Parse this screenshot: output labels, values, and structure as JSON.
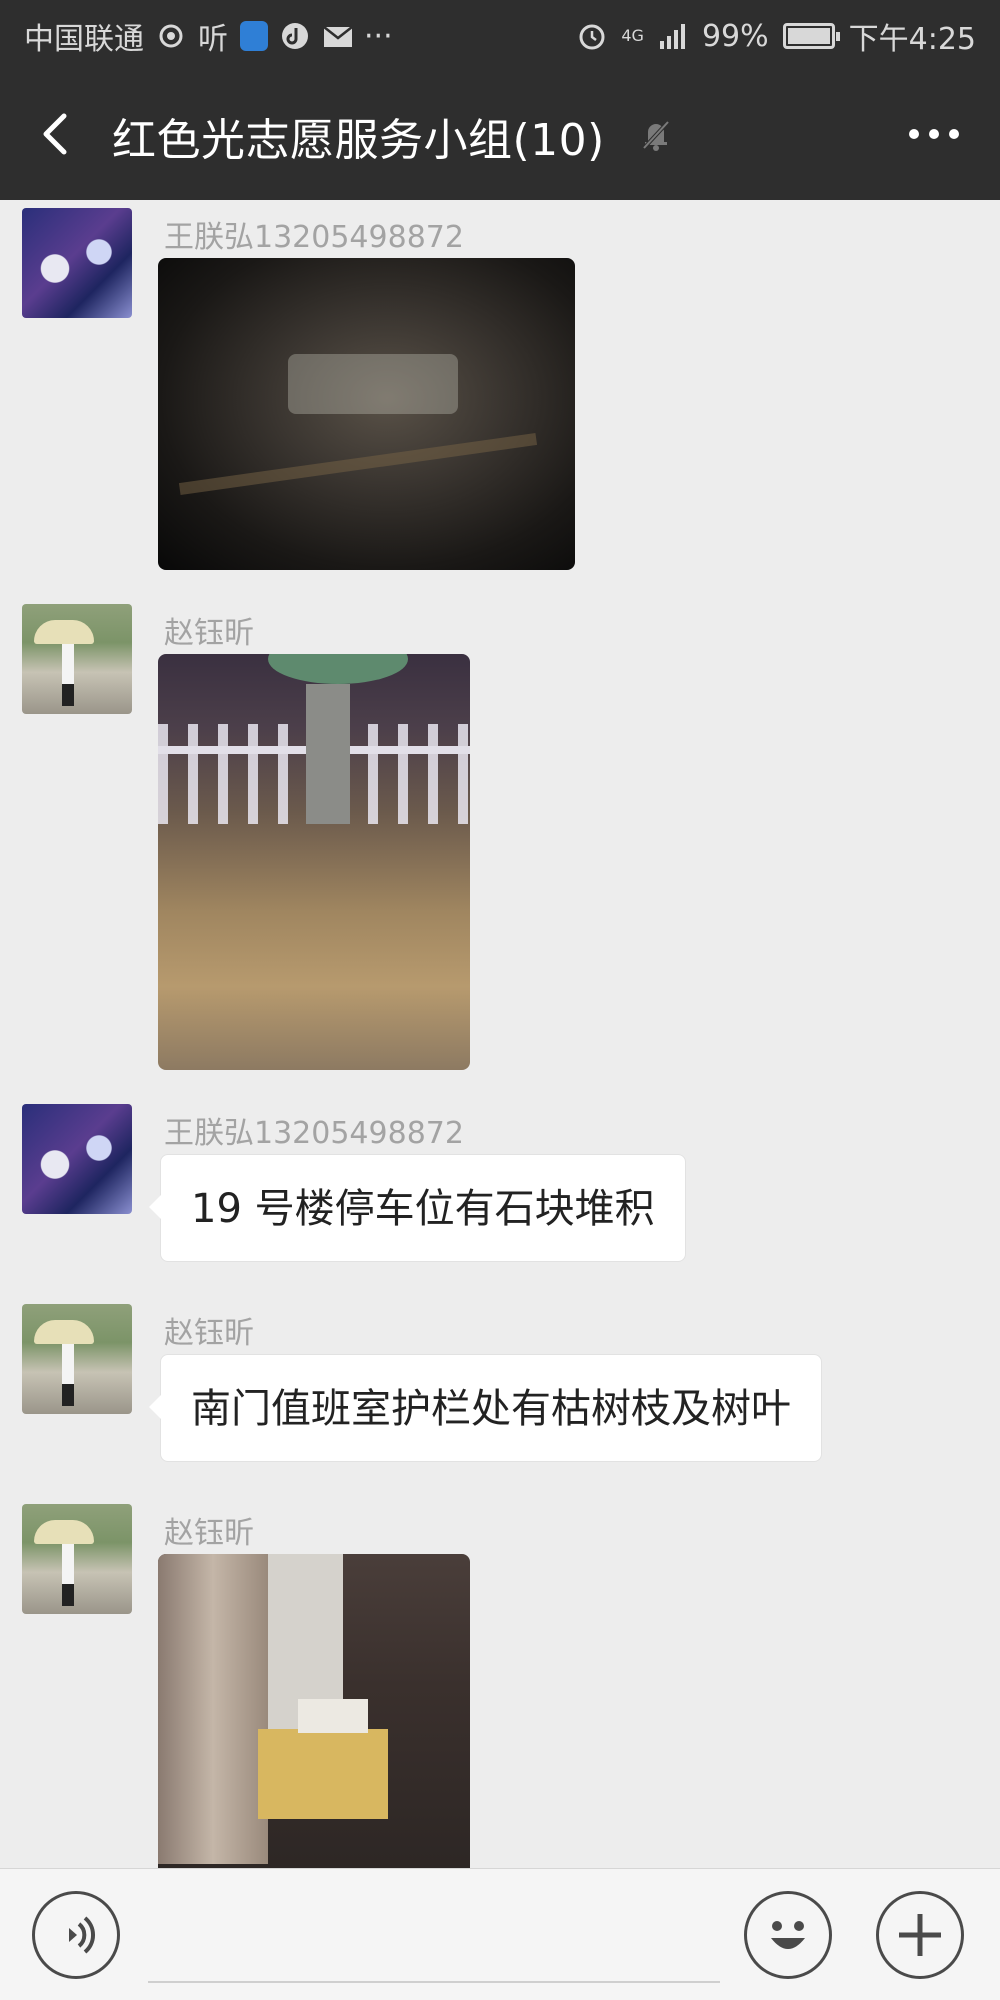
{
  "status_bar": {
    "carrier": "中国联通",
    "ting": "听",
    "more": "···",
    "network": "4G",
    "battery_percent": "99%",
    "battery_level": 0.99,
    "time": "下午4:25"
  },
  "nav": {
    "title": "红色光志愿服务小组(10)"
  },
  "messages": [
    {
      "sender": "王朕弘13205498872",
      "type": "image",
      "avatar": "anime-avatar",
      "image": "night-parking-debris-photo"
    },
    {
      "sender": "赵钰昕",
      "type": "image",
      "avatar": "umbrella-avatar",
      "image": "fence-fallen-leaves-photo"
    },
    {
      "sender": "王朕弘13205498872",
      "type": "text",
      "avatar": "anime-avatar",
      "text": "19 号楼停车位有石块堆积"
    },
    {
      "sender": "赵钰昕",
      "type": "text",
      "avatar": "umbrella-avatar",
      "text": "南门值班室护栏处有枯树枝及树叶"
    },
    {
      "sender": "赵钰昕",
      "type": "image",
      "avatar": "umbrella-avatar",
      "image": "room-table-photo"
    }
  ],
  "input_bar": {
    "voice_icon": "voice-icon",
    "emoji_icon": "emoji-icon",
    "plus_icon": "plus-icon"
  },
  "colors": {
    "header_bg": "#2e2e2e",
    "chat_bg": "#ededed",
    "bubble_bg": "#ffffff",
    "sender_text": "#a3a3a3"
  }
}
